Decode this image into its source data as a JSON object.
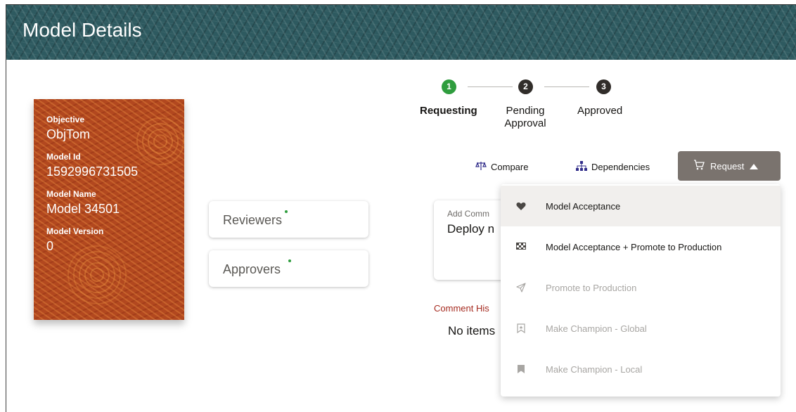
{
  "header": {
    "title": "Model Details"
  },
  "model_card": {
    "objective_label": "Objective",
    "objective_value": "ObjTom",
    "model_id_label": "Model Id",
    "model_id_value": "1592996731505",
    "model_name_label": "Model Name",
    "model_name_value": "Model 34501",
    "model_version_label": "Model Version",
    "model_version_value": "0"
  },
  "reviewers": {
    "label": "Reviewers"
  },
  "approvers": {
    "label": "Approvers"
  },
  "stepper": {
    "steps": [
      {
        "number": "1",
        "label": "Requesting",
        "state": "active",
        "color": "#2f9d3e"
      },
      {
        "number": "2",
        "label_line1": "Pending",
        "label_line2": "Approval",
        "state": "pending",
        "color": "#312d2a"
      },
      {
        "number": "3",
        "label": "Approved",
        "state": "pending",
        "color": "#312d2a"
      }
    ]
  },
  "toolbar": {
    "compare_label": "Compare",
    "dependencies_label": "Dependencies",
    "request_label": "Request",
    "request_icon": "cart-icon",
    "request_bg": "#7a736e"
  },
  "comment": {
    "placeholder": "Add Comm",
    "value": "Deploy n",
    "history_label": "Comment His",
    "no_items": "No items"
  },
  "request_menu": {
    "items": [
      {
        "label": "Model Acceptance",
        "icon": "heart-icon",
        "enabled": true,
        "highlighted": true
      },
      {
        "label": "Model Acceptance + Promote to Production",
        "icon": "checkered-flag-icon",
        "enabled": true,
        "highlighted": false
      },
      {
        "label": "Promote to Production",
        "icon": "send-icon",
        "enabled": false,
        "highlighted": false
      },
      {
        "label": "Make Champion - Global",
        "icon": "bookmark-outline-icon",
        "enabled": false,
        "highlighted": false
      },
      {
        "label": "Make Champion - Local",
        "icon": "bookmark-icon",
        "enabled": false,
        "highlighted": false
      }
    ]
  }
}
